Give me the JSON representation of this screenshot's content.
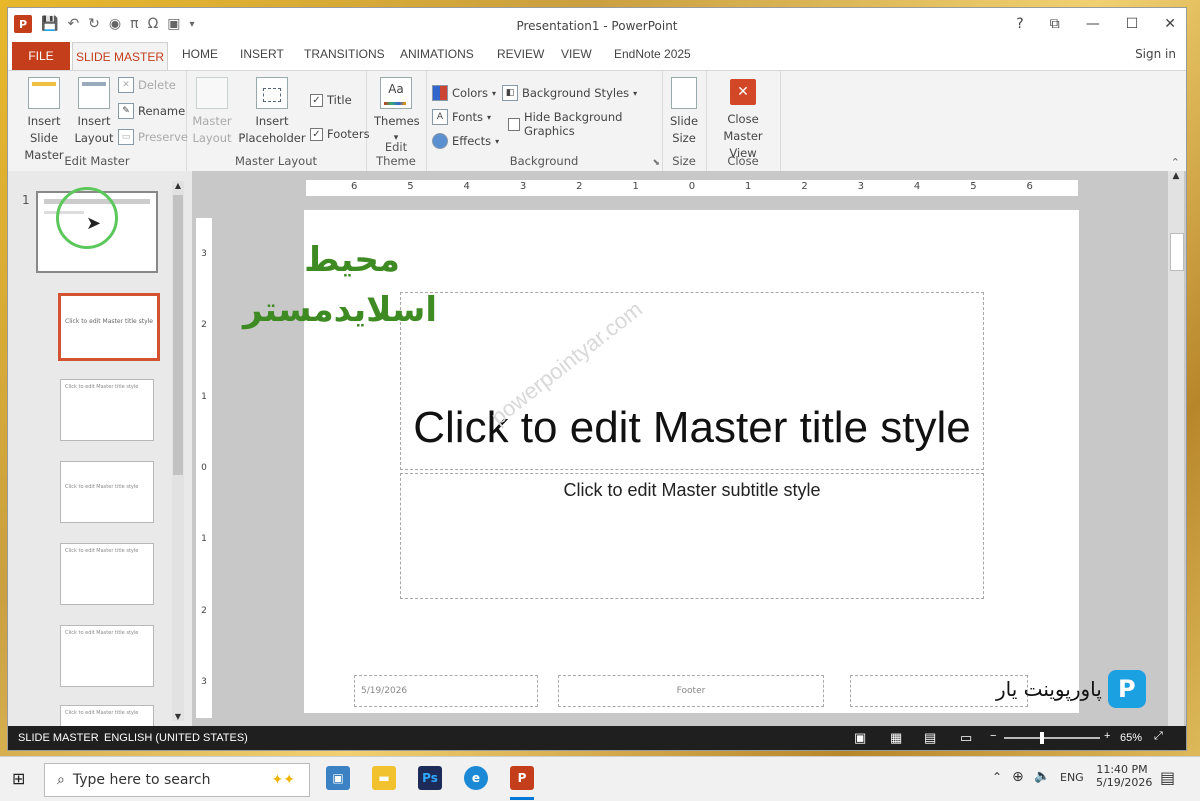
{
  "window": {
    "title": "Presentation1 - PowerPoint",
    "controls": [
      "?",
      "⧉",
      "—",
      "☐",
      "✕"
    ]
  },
  "qat": {
    "undo": "↶",
    "redo": "↻",
    "pi": "π",
    "omega": "Ω"
  },
  "tabs": [
    "FILE",
    "SLIDE MASTER",
    "HOME",
    "INSERT",
    "TRANSITIONS",
    "ANIMATIONS",
    "REVIEW",
    "VIEW",
    "EndNote 2025"
  ],
  "sign_in": "Sign in",
  "ribbon": {
    "edit_master": {
      "label": "Edit Master",
      "insert_slide_master": [
        "Insert Slide",
        "Master"
      ],
      "insert_layout": [
        "Insert",
        "Layout"
      ],
      "delete": "Delete",
      "rename": "Rename",
      "preserve": "Preserve"
    },
    "master_layout": {
      "label": "Master Layout",
      "master_layout_btn": [
        "Master",
        "Layout"
      ],
      "insert_placeholder": [
        "Insert",
        "Placeholder"
      ],
      "title_chk": "Title",
      "footers_chk": "Footers"
    },
    "edit_theme": {
      "label": "Edit Theme",
      "themes": "Themes"
    },
    "background": {
      "label": "Background",
      "colors": "Colors",
      "fonts": "Fonts",
      "effects": "Effects",
      "background_styles": "Background Styles",
      "hide_bg": "Hide Background Graphics"
    },
    "size": {
      "label": "Size",
      "slide_size": [
        "Slide",
        "Size"
      ]
    },
    "close": {
      "label": "Close",
      "close_master": [
        "Close",
        "Master View"
      ]
    }
  },
  "thumbnails": {
    "first_number": "1",
    "titles": [
      "Click to edit Master title style",
      "Click to edit Master title style",
      "Click to edit Master title style",
      "Click to edit Master title style",
      "Click to edit Master title style",
      "Click to edit Master title style"
    ]
  },
  "ruler": {
    "h_labels": [
      "6",
      "5",
      "4",
      "3",
      "2",
      "1",
      "0",
      "1",
      "2",
      "3",
      "4",
      "5",
      "6"
    ],
    "v_labels": [
      "3",
      "2",
      "1",
      "0",
      "1",
      "2",
      "3"
    ]
  },
  "slide": {
    "title": "Click to edit Master title style",
    "subtitle": "Click to edit Master subtitle style",
    "date": "5/19/2026",
    "footer": "Footer",
    "watermark": "powerpointyar.com"
  },
  "overlay": {
    "line1": "محیط",
    "line2": "اسلایدمستر"
  },
  "brand": {
    "text": "پاورپوینت یار",
    "logo_letter": "P"
  },
  "statusbar": {
    "mode": "SLIDE MASTER",
    "language": "ENGLISH (UNITED STATES)",
    "zoom": "65%"
  },
  "taskbar": {
    "search_placeholder": "Type here to search",
    "lang": "ENG",
    "time": "11:40 PM",
    "date": "5/19/2026"
  },
  "colors": {
    "accent": "#c43e1c",
    "overlay_green": "#3d8b22"
  }
}
